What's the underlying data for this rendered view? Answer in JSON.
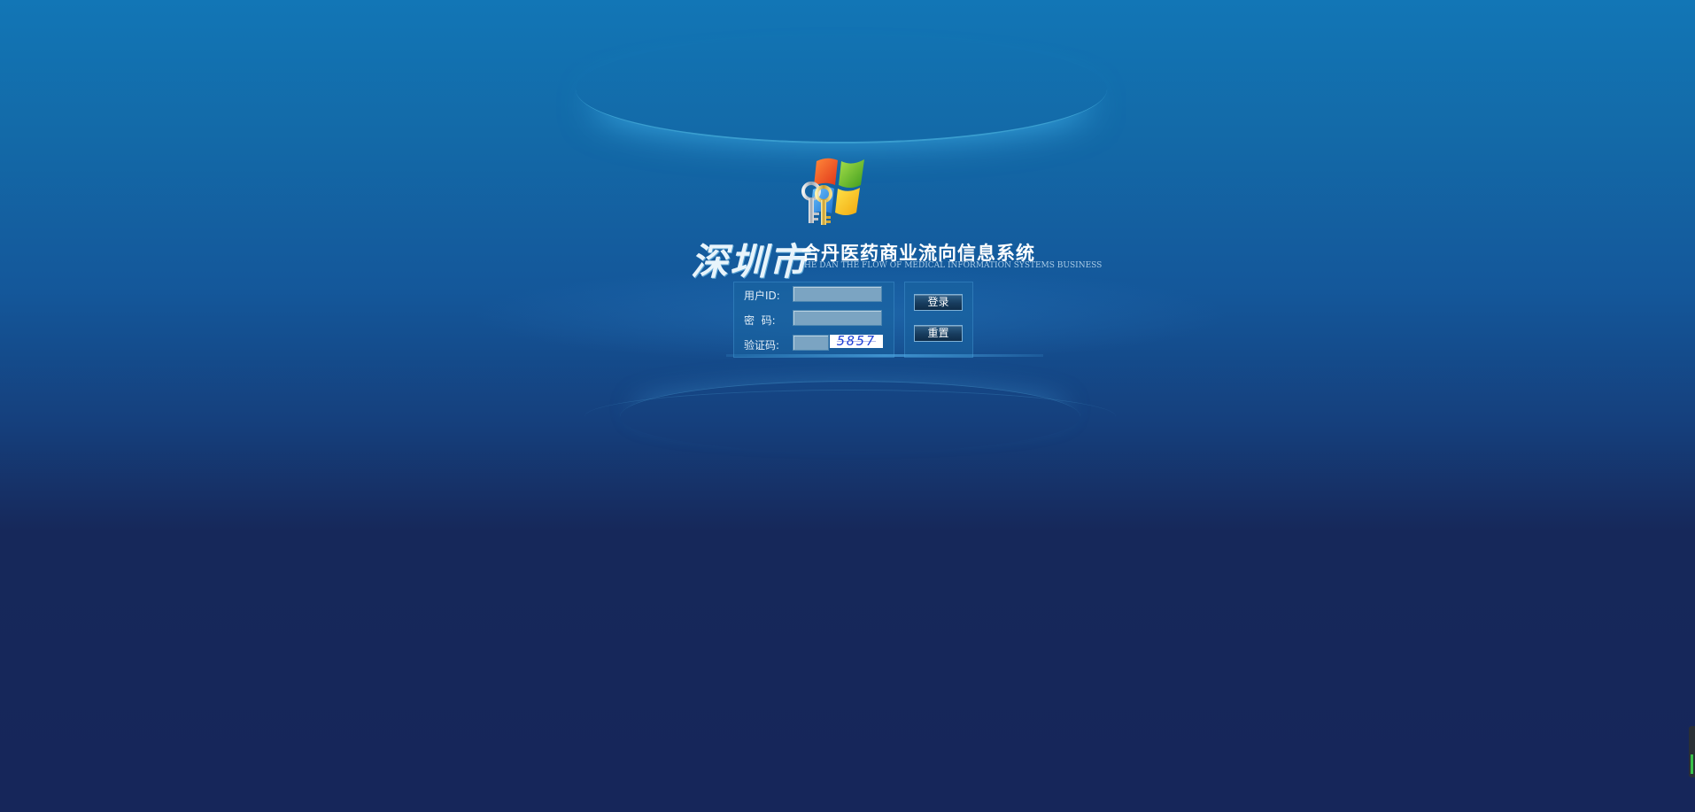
{
  "app": {
    "city_title": "深圳市",
    "system_title": "合丹医药商业流向信息系统",
    "system_title_en": "HE DAN THE FLOW OF MEDICAL INFORMATION SYSTEMS BUSINESS"
  },
  "login_form": {
    "user_id_label": "用户ID:",
    "user_id_value": "",
    "password_label": "密  码:",
    "password_value": "",
    "captcha_label": "验证码:",
    "captcha_value": "",
    "captcha_code": "5857"
  },
  "buttons": {
    "login_label": "登录",
    "reset_label": "重置"
  },
  "icons": {
    "logo": "windows-flag-with-keys-icon"
  },
  "colors": {
    "background_top": "#1276b6",
    "background_bottom": "#16265a",
    "input_fill": "#7ba4c2",
    "captcha_text": "#1d3fd6"
  }
}
